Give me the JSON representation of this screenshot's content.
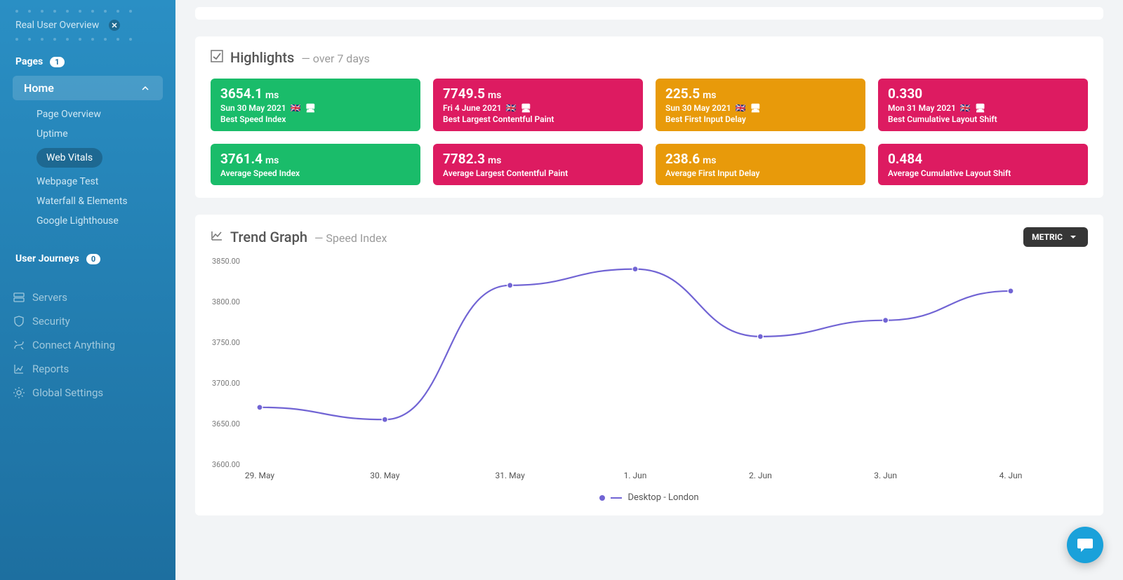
{
  "sidebar": {
    "overview_label": "Real User Overview",
    "pages_label": "Pages",
    "pages_count": "1",
    "home_label": "Home",
    "subitems": [
      {
        "label": "Page Overview",
        "active": false
      },
      {
        "label": "Uptime",
        "active": false
      },
      {
        "label": "Web Vitals",
        "active": true
      },
      {
        "label": "Webpage Test",
        "active": false
      },
      {
        "label": "Waterfall & Elements",
        "active": false
      },
      {
        "label": "Google Lighthouse",
        "active": false
      }
    ],
    "journeys_label": "User Journeys",
    "journeys_count": "0",
    "main_nav": [
      {
        "icon": "server-icon",
        "label": "Servers"
      },
      {
        "icon": "shield-icon",
        "label": "Security"
      },
      {
        "icon": "plug-icon",
        "label": "Connect Anything"
      },
      {
        "icon": "chart-icon",
        "label": "Reports"
      },
      {
        "icon": "gear-icon",
        "label": "Global Settings"
      }
    ]
  },
  "highlights": {
    "title": "Highlights",
    "subtitle": "— over 7 days",
    "tiles": [
      {
        "color": "green",
        "value": "3654.1",
        "unit": "ms",
        "date": "Sun 30 May 2021",
        "flag": "🇬🇧",
        "monitor": "🖥",
        "label": "Best Speed Index"
      },
      {
        "color": "magenta",
        "value": "7749.5",
        "unit": "ms",
        "date": "Fri 4 June 2021",
        "flag": "🇬🇧",
        "monitor": "🖥",
        "label": "Best Largest Contentful Paint"
      },
      {
        "color": "orange",
        "value": "225.5",
        "unit": "ms",
        "date": "Sun 30 May 2021",
        "flag": "🇬🇧",
        "monitor": "🖥",
        "label": "Best First Input Delay"
      },
      {
        "color": "magenta",
        "value": "0.330",
        "unit": "",
        "date": "Mon 31 May 2021",
        "flag": "🇬🇧",
        "monitor": "🖥",
        "label": "Best Cumulative Layout Shift"
      },
      {
        "color": "green",
        "value": "3761.4",
        "unit": "ms",
        "label2": "Average Speed Index"
      },
      {
        "color": "magenta",
        "value": "7782.3",
        "unit": "ms",
        "label2": "Average Largest Contentful Paint"
      },
      {
        "color": "orange",
        "value": "238.6",
        "unit": "ms",
        "label2": "Average First Input Delay"
      },
      {
        "color": "magenta",
        "value": "0.484",
        "unit": "",
        "label2": "Average Cumulative Layout Shift"
      }
    ]
  },
  "trend": {
    "title": "Trend Graph",
    "subtitle": "— Speed Index",
    "metric_button": "METRIC",
    "legend": "Desktop - London"
  },
  "chart_data": {
    "type": "line",
    "x": [
      "29. May",
      "30. May",
      "31. May",
      "1. Jun",
      "2. Jun",
      "3. Jun",
      "4. Jun"
    ],
    "series": [
      {
        "name": "Desktop - London",
        "values": [
          3670,
          3655,
          3820,
          3840,
          3757,
          3777,
          3813
        ]
      }
    ],
    "ylabel": "",
    "xlabel": "",
    "ylim": [
      3600,
      3850
    ],
    "y_ticks": [
      3600,
      3650,
      3700,
      3750,
      3800,
      3850
    ],
    "color": "#7164d4"
  }
}
